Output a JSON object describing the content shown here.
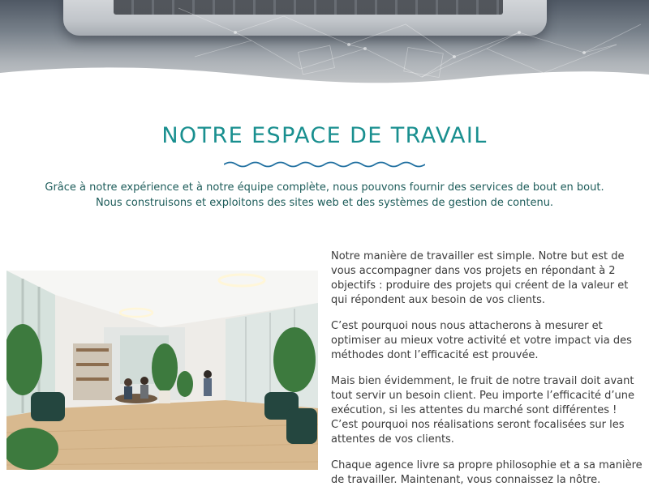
{
  "hero": {
    "image": "laptop-keyboard-photo"
  },
  "section": {
    "title": "NOTRE ESPACE DE TRAVAIL",
    "intro": "Grâce à notre expérience et à notre équipe complète, nous pouvons fournir des services de bout en bout. Nous construisons et exploitons des sites web et des systèmes de gestion de contenu."
  },
  "photo": {
    "image": "office-workspace-photo"
  },
  "paragraphs": [
    "Notre manière de travailler est simple. Notre but est de vous accompagner dans vos projets en répondant à 2 objectifs : produire des projets qui créent de la valeur et qui répondent aux besoin de vos clients.",
    "C’est pourquoi nous nous attacherons à mesurer et optimiser au mieux votre activité et votre impact via des méthodes dont l’efficacité est prouvée.",
    "Mais bien évidemment, le fruit de notre travail doit avant tout servir un besoin client. Peu importe l’efficacité d’une exécution, si les attentes du marché sont différentes ! C’est pourquoi nos réalisations seront focalisées sur les attentes de vos clients.",
    "Chaque agence livre sa propre philosophie et a sa manière de travailler. Maintenant, vous connaissez la nôtre."
  ],
  "colors": {
    "accent": "#198f8f",
    "intro_text": "#1d5c5a",
    "body_text": "#3a3a3a",
    "wave_divider": "#1f6fa0"
  }
}
